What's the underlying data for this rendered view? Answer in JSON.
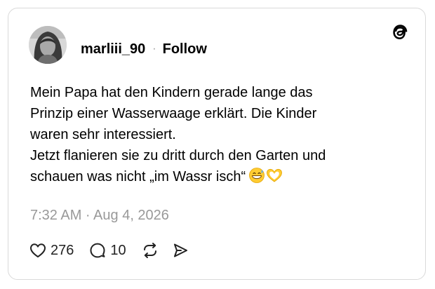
{
  "post": {
    "username": "marliii_90",
    "separator": "·",
    "follow_label": "Follow",
    "text_lines": [
      "Mein Papa hat den Kindern gerade lange das",
      "Prinzip einer Wasserwaage erklärt. Die Kinder",
      "waren sehr interessiert.",
      "Jetzt flanieren sie zu dritt durch den Garten und",
      "schauen was nicht „im Wassr isch“"
    ],
    "emojis": [
      "grinning-sweat-emoji",
      "heart-hands-emoji"
    ],
    "timestamp": "7:32 AM · Aug 4, 2026"
  },
  "actions": {
    "likes": "276",
    "replies": "10"
  },
  "icons": {
    "logo": "threads-logo-icon",
    "like": "heart-icon",
    "reply": "speech-bubble-icon",
    "repost": "repost-icon",
    "share": "send-icon"
  }
}
